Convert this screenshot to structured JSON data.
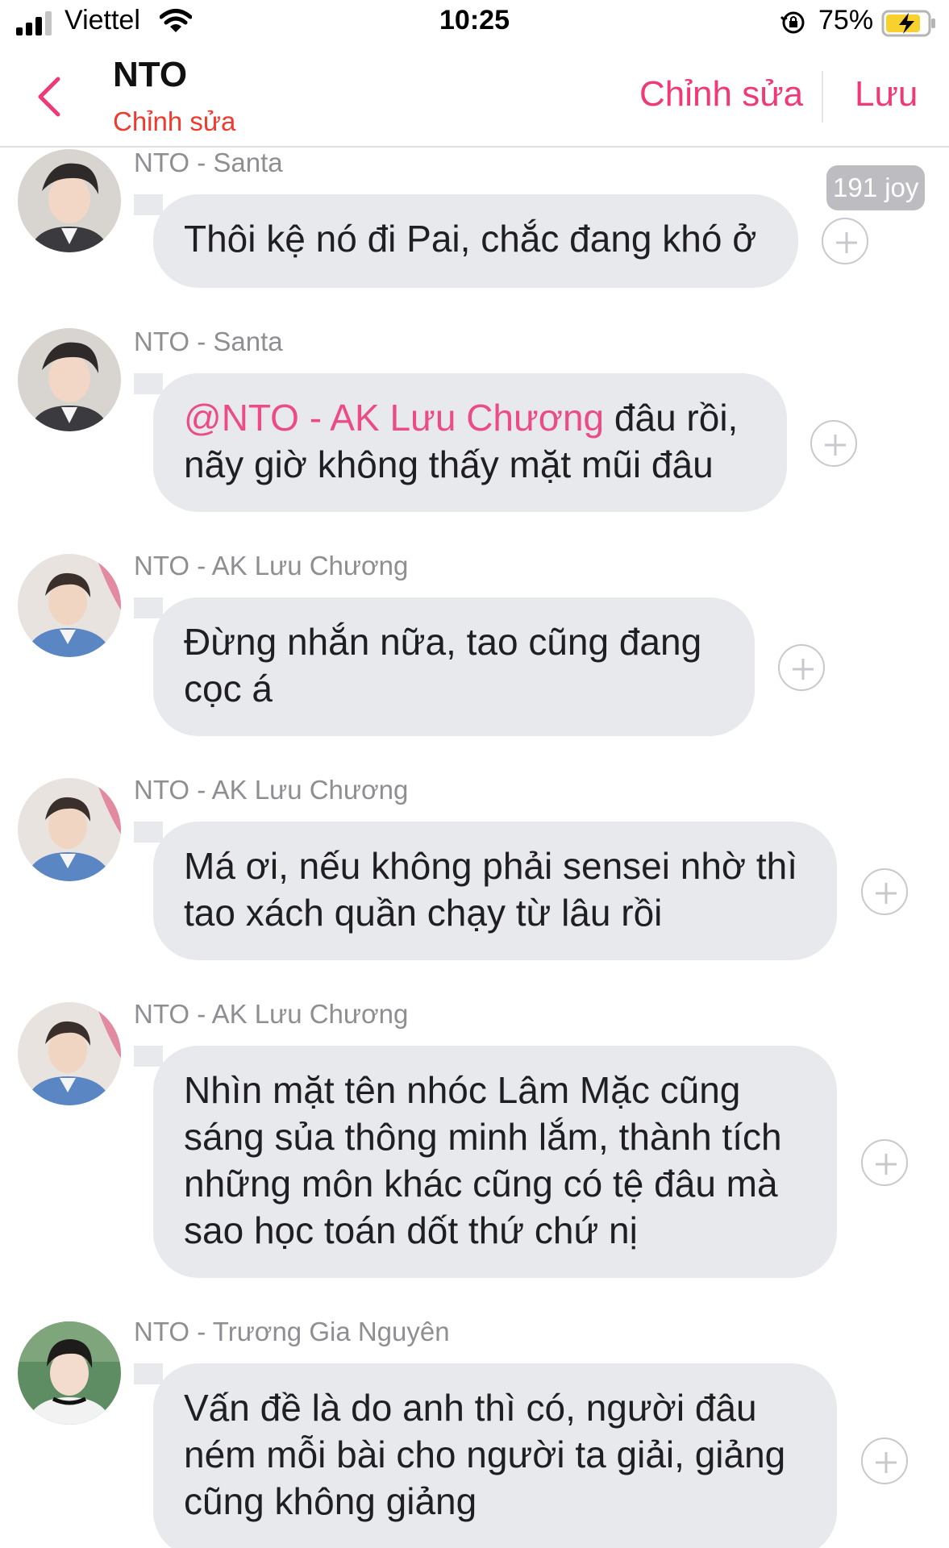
{
  "status_bar": {
    "carrier": "Viettel",
    "time": "10:25",
    "battery_percent": "75%",
    "icons": [
      "signal-icon",
      "wifi-icon",
      "orientation-lock-icon",
      "battery-charging-icon"
    ]
  },
  "nav": {
    "title": "NTO",
    "subtitle": "Chỉnh sửa",
    "edit_label": "Chỉnh sửa",
    "save_label": "Lưu",
    "accent_color": "#f03a78"
  },
  "joy_badge": "191 joy",
  "messages": [
    {
      "sender": "NTO - Santa",
      "text": "Thôi kệ nó đi Pai, chắc đang khó ở"
    },
    {
      "sender": "NTO - Santa",
      "mention": "@NTO - AK Lưu Chương",
      "text": " đâu rồi, nãy giờ không thấy mặt mũi đâu"
    },
    {
      "sender": "NTO - AK Lưu Chương",
      "text": "Đừng nhắn nữa, tao cũng đang cọc á"
    },
    {
      "sender": "NTO - AK Lưu Chương",
      "text": "Má ơi, nếu không phải sensei nhờ thì tao xách quần chạy từ lâu rồi"
    },
    {
      "sender": "NTO - AK Lưu Chương",
      "text": "Nhìn mặt tên nhóc Lâm Mặc cũng sáng sủa thông minh lắm, thành tích những môn khác cũng có tệ đâu mà sao học toán dốt thứ chứ nị"
    },
    {
      "sender": "NTO - Trương Gia Nguyên",
      "text": "Vấn đề là do anh thì có, người đâu ném mỗi bài cho người ta giải, giảng cũng không giảng"
    }
  ]
}
